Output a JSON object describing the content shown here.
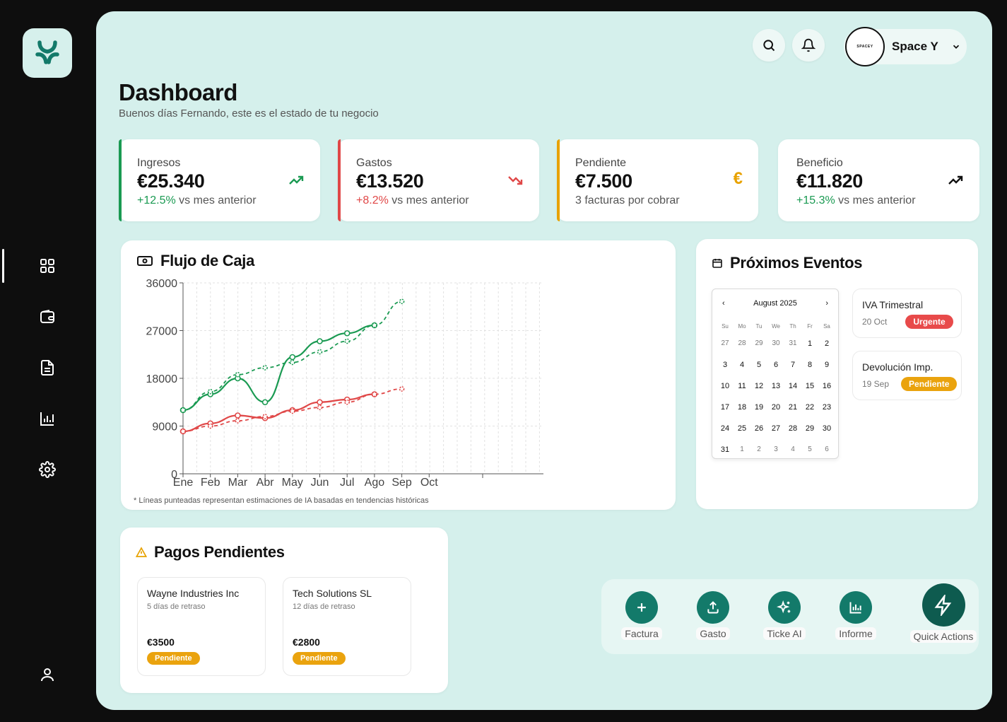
{
  "brand": {
    "accent": "#137a6a",
    "panel_bg": "#d5f0ec"
  },
  "sidebar": {
    "items": [
      {
        "icon": "dashboard-grid-icon",
        "active": true
      },
      {
        "icon": "wallet-icon"
      },
      {
        "icon": "document-icon"
      },
      {
        "icon": "bar-chart-icon"
      },
      {
        "icon": "gear-icon"
      },
      {
        "icon": "user-icon"
      }
    ]
  },
  "header": {
    "title": "Dashboard",
    "subtitle": "Buenos días Fernando, este es el estado de tu negocio",
    "account": {
      "name": "Space Y",
      "avatar_text": "SPACEY"
    }
  },
  "stats": [
    {
      "label": "Ingresos",
      "value": "€25.340",
      "change": "+12.5%",
      "note": " vs mes anterior",
      "color": "#1a9a52",
      "icon": "trending-up-icon"
    },
    {
      "label": "Gastos",
      "value": "€13.520",
      "change": "+8.2%",
      "note": " vs mes anterior",
      "color": "#e04848",
      "icon": "trending-down-icon"
    },
    {
      "label": "Pendiente",
      "value": "€7.500",
      "change": "",
      "note": "3 facturas por cobrar",
      "color": "#e8a200",
      "icon": "euro-icon"
    },
    {
      "label": "Beneficio",
      "value": "€11.820",
      "change": "+15.3%",
      "note": " vs mes anterior",
      "color": "#1a9a52",
      "icon": "trending-up-icon"
    }
  ],
  "cashflow": {
    "title": "Flujo de Caja",
    "footnote": "* Líneas punteadas representan estimaciones de IA basadas en tendencias históricas"
  },
  "chart_data": {
    "type": "line",
    "title": "Flujo de Caja",
    "categories": [
      "Ene",
      "Feb",
      "Mar",
      "Abr",
      "May",
      "Jun",
      "Jul",
      "Ago",
      "Sep",
      "Oct"
    ],
    "ylim": [
      0,
      36000
    ],
    "yticks": [
      0,
      9000,
      18000,
      27000,
      36000
    ],
    "grid": true,
    "series": [
      {
        "name": "",
        "color": "#1a9a52",
        "style": "solid",
        "values": [
          12000,
          15000,
          18000,
          13500,
          22000,
          25000,
          26500,
          28000,
          null,
          null
        ]
      },
      {
        "name": "",
        "color": "#1a9a52",
        "style": "dashed",
        "values": [
          12000,
          15500,
          18700,
          20000,
          21000,
          23000,
          25000,
          28000,
          32500,
          null
        ]
      },
      {
        "name": "",
        "color": "#e04848",
        "style": "solid",
        "values": [
          8000,
          9500,
          11000,
          10500,
          12000,
          13500,
          14000,
          15000,
          null,
          null
        ]
      },
      {
        "name": "",
        "color": "#e04848",
        "style": "dashed",
        "values": [
          8000,
          9000,
          10000,
          10800,
          11800,
          12500,
          13500,
          15000,
          16000,
          null
        ]
      }
    ]
  },
  "events": {
    "title": "Próximos Eventos",
    "calendar": {
      "month": "August 2025",
      "weekdays": [
        "Su",
        "Mo",
        "Tu",
        "We",
        "Th",
        "Fr",
        "Sa"
      ],
      "days": [
        [
          "27",
          "28",
          "29",
          "30",
          "31",
          "1",
          "2"
        ],
        [
          "3",
          "4",
          "5",
          "6",
          "7",
          "8",
          "9"
        ],
        [
          "10",
          "11",
          "12",
          "13",
          "14",
          "15",
          "16"
        ],
        [
          "17",
          "18",
          "19",
          "20",
          "21",
          "22",
          "23"
        ],
        [
          "24",
          "25",
          "26",
          "27",
          "28",
          "29",
          "30"
        ],
        [
          "31",
          "1",
          "2",
          "3",
          "4",
          "5",
          "6"
        ]
      ]
    },
    "items": [
      {
        "title": "IVA Trimestral",
        "date": "20 Oct",
        "badge": "Urgente",
        "badge_color": "#e84a4a"
      },
      {
        "title": "Devolución Imp.",
        "date": "19 Sep",
        "badge": "Pendiente",
        "badge_color": "#eaa30e"
      }
    ]
  },
  "payments": {
    "title": "Pagos Pendientes",
    "items": [
      {
        "name": "Wayne Industries Inc",
        "delay": "5 días de retraso",
        "amount": "€3500",
        "status": "Pendiente"
      },
      {
        "name": "Tech Solutions SL",
        "delay": "12 días de retraso",
        "amount": "€2800",
        "status": "Pendiente"
      }
    ]
  },
  "quick_actions": {
    "items": [
      {
        "label": "Factura",
        "icon": "plus-icon"
      },
      {
        "label": "Gasto",
        "icon": "upload-icon"
      },
      {
        "label": "Ticke AI",
        "icon": "sparkles-icon"
      },
      {
        "label": "Informe",
        "icon": "report-chart-icon"
      }
    ],
    "main_label": "Quick Actions",
    "main_icon": "lightning-icon"
  }
}
